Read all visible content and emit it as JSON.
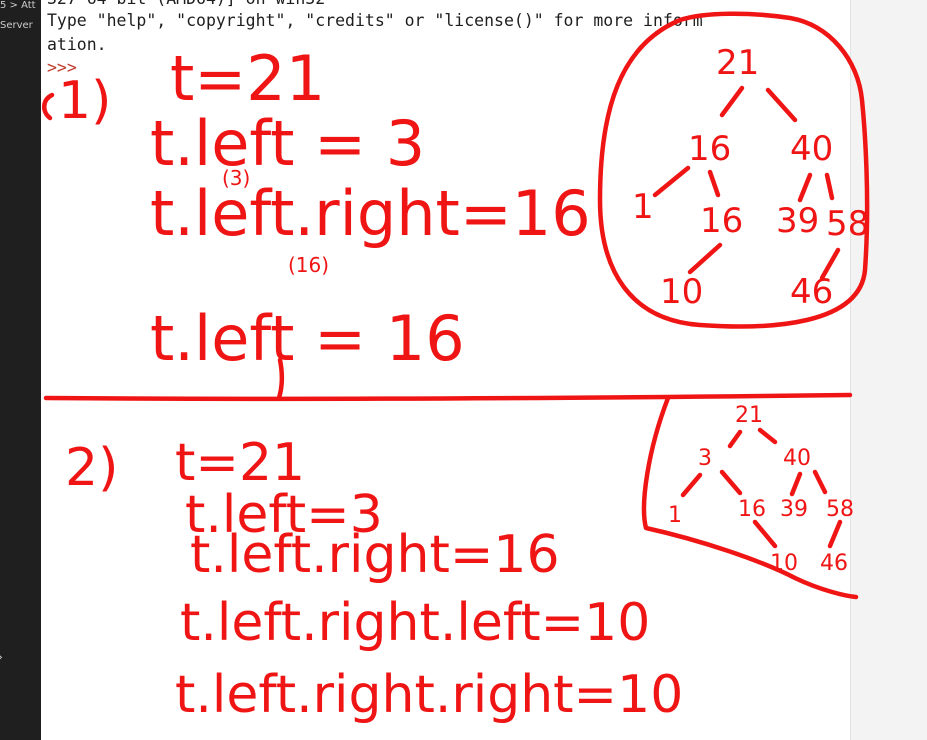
{
  "sidebar": {
    "breadcrumb": "5 > Att",
    "server_label": "Server"
  },
  "console": {
    "lines": [
      "327 64 bit (AMD64)] on win32",
      "Type \"help\", \"copyright\", \"credits\" or \"license()\" for more inform",
      "ation.",
      ">>>"
    ]
  },
  "notes": {
    "section1": {
      "number": "1)",
      "line1": "t=21",
      "line2": "t.left = 3",
      "line2_sub": "(3)",
      "line3": "t.left.right=16",
      "line3_sub": "(16)",
      "line4": "t.left = 16",
      "tree": {
        "root": "21",
        "l": "16",
        "r": "40",
        "ll": "1",
        "lr": "16",
        "rl": "39",
        "rr": "58",
        "lrl": "10",
        "rrl": "46"
      }
    },
    "section2": {
      "number": "2)",
      "line1": "t=21",
      "line2": "t.left=3",
      "line3": "t.left.right=16",
      "line4": "t.left.right.left=10",
      "line5": "t.left.right.right=10",
      "tree": {
        "root": "21",
        "l": "3",
        "r": "40",
        "ll": "1",
        "lr": "16",
        "rl": "39",
        "rr": "58",
        "lrl": "10",
        "rrl": "46"
      }
    }
  },
  "colors": {
    "ink": "#f01515",
    "sidebar": "#1f1f1f",
    "console_bg": "#ffffff",
    "text": "#1e1e1e"
  }
}
